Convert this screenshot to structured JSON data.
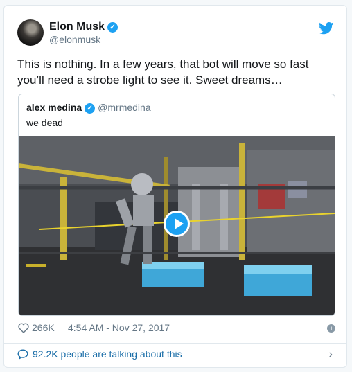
{
  "author": {
    "name": "Elon Musk",
    "handle": "@elonmusk"
  },
  "tweet": {
    "text": "This is nothing. In a few years, that bot will move so fast you’ll need a strobe light to see it. Sweet dreams…"
  },
  "quoted": {
    "name": "alex medina",
    "handle": "@mrmedina",
    "text": "we dead"
  },
  "stats": {
    "likes": "266K",
    "timestamp": "4:54 AM - Nov 27, 2017"
  },
  "footer": {
    "talking": "92.2K people are talking about this"
  },
  "icons": {
    "info": "i",
    "chevron": "›",
    "verified": "✓"
  },
  "colors": {
    "accent": "#1da1f2",
    "link": "#1b6ea8",
    "muted": "#657786"
  }
}
